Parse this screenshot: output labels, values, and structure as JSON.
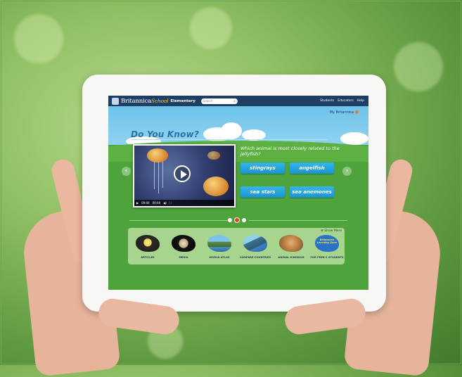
{
  "app": {
    "logo_brand": "Britannica",
    "logo_suffix": "School",
    "level": "Elementary",
    "search_placeholder": "Search",
    "nav": [
      "Students",
      "Educators",
      "Help"
    ],
    "my_britannica": "My Britannica"
  },
  "quiz": {
    "heading": "Do You Know?",
    "question": "Which animal is most closely related to the jellyfish?",
    "answers": [
      "stingrays",
      "angelfish",
      "sea stars",
      "sea anemones"
    ],
    "video": {
      "time_current": "00:00",
      "time_total": "00:00"
    }
  },
  "carousel": {
    "pages": 1,
    "active_page": 1
  },
  "tray": {
    "show_more": "Show More",
    "tiles": [
      {
        "label": "ARTICLES",
        "icon": "flower-icon"
      },
      {
        "label": "MEDIA",
        "icon": "planet-icon"
      },
      {
        "label": "WORLD ATLAS",
        "icon": "landscape-icon"
      },
      {
        "label": "COMPARE COUNTRIES",
        "icon": "mountains-icon"
      },
      {
        "label": "ANIMAL KINGDOM",
        "icon": "lion-icon"
      },
      {
        "label": "FOR PREK-2 STUDENTS",
        "icon": "learning-zone-icon",
        "badge": "Britannica Learning Zone"
      }
    ]
  },
  "colors": {
    "topbar": "#1e3f63",
    "answer_button": "#1b93cf",
    "screen_green": "#4ea33b",
    "active_dot": "#e8421e"
  }
}
